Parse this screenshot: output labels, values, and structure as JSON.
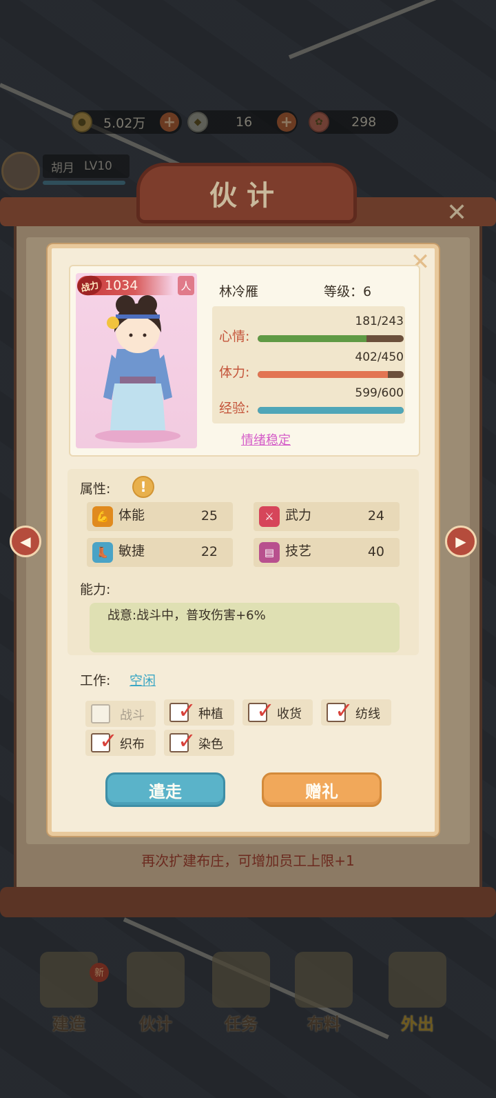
{
  "resources": {
    "coins": "5.02万",
    "gems": "16",
    "flowers": "298"
  },
  "player": {
    "name": "胡月",
    "level": "LV10"
  },
  "panel": {
    "title": "伙计",
    "hint": "再次扩建布庄，可增加员工上限+1"
  },
  "character": {
    "power_tag": "战力",
    "power": "1034",
    "race_tag": "人",
    "name": "林冷雁",
    "level_label": "等级：6",
    "stats": [
      {
        "label": "心情:",
        "value": "181/243",
        "current": 181,
        "max": 243,
        "color": "#5f9a44"
      },
      {
        "label": "体力:",
        "value": "402/450",
        "current": 402,
        "max": 450,
        "color": "#e27452"
      },
      {
        "label": "经验:",
        "value": "599/600",
        "current": 599,
        "max": 600,
        "color": "#4fa6b8"
      }
    ],
    "mood": "情绪稳定"
  },
  "attributes": {
    "label": "属性:",
    "info_icon": "!",
    "items": [
      {
        "name": "体能",
        "value": "25",
        "icon": "muscle-icon",
        "color": "#e08a1e"
      },
      {
        "name": "武力",
        "value": "24",
        "icon": "sword-icon",
        "color": "#d6455a"
      },
      {
        "name": "敏捷",
        "value": "22",
        "icon": "boot-icon",
        "color": "#4aa3c6"
      },
      {
        "name": "技艺",
        "value": "40",
        "icon": "scroll-icon",
        "color": "#b8508e"
      }
    ]
  },
  "ability": {
    "label": "能力:",
    "text": "战意:战斗中，普攻伤害+6%"
  },
  "work": {
    "label": "工作:",
    "status": "空闲",
    "options": [
      {
        "label": "战斗",
        "checked": false
      },
      {
        "label": "种植",
        "checked": true
      },
      {
        "label": "收货",
        "checked": true
      },
      {
        "label": "纺线",
        "checked": true
      },
      {
        "label": "织布",
        "checked": true
      },
      {
        "label": "染色",
        "checked": true
      }
    ]
  },
  "buttons": {
    "dismiss": "遣走",
    "gift": "赠礼"
  },
  "bottom_nav": {
    "new_badge": "新",
    "items": [
      "建造",
      "伙计",
      "任务",
      "布料",
      "外出"
    ]
  }
}
